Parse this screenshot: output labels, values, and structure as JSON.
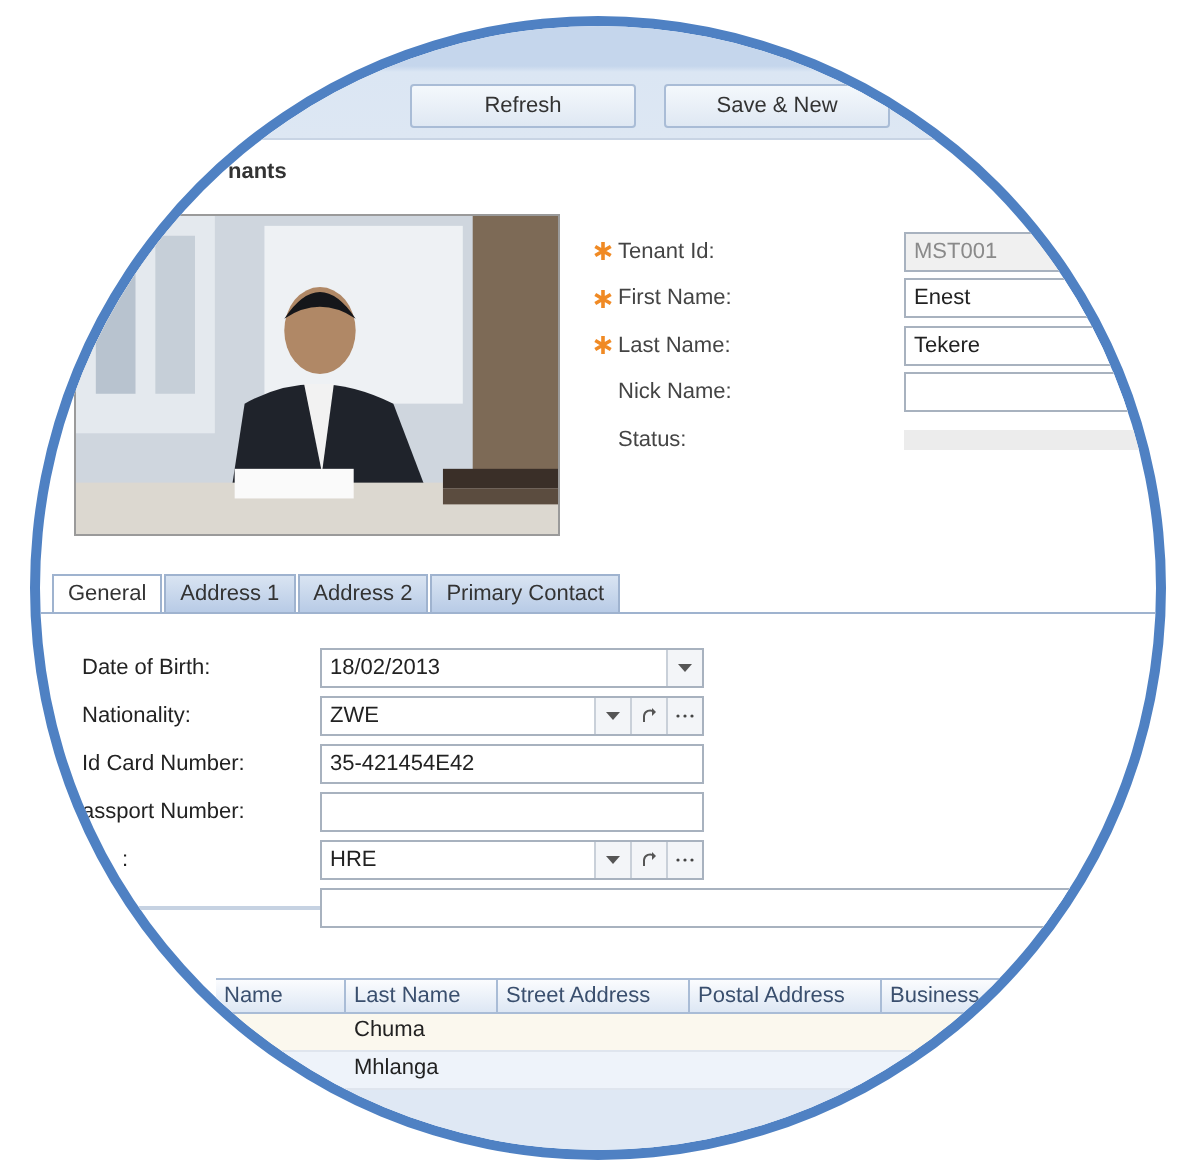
{
  "toolbar": {
    "buttons": [
      "Refresh",
      "Save & New"
    ]
  },
  "title": "nants",
  "tenant_fields": [
    {
      "label": "Tenant Id:",
      "required": true,
      "value": "MST001",
      "disabled": true,
      "kind": "text"
    },
    {
      "label": "First Name:",
      "required": true,
      "value": "Enest",
      "disabled": false,
      "kind": "text"
    },
    {
      "label": "Last Name:",
      "required": true,
      "value": "Tekere",
      "disabled": false,
      "kind": "text"
    },
    {
      "label": "Nick Name:",
      "required": false,
      "disabled": false,
      "kind": "text"
    },
    {
      "label": "Status:",
      "required": false,
      "disabled": true,
      "kind": "status"
    }
  ],
  "tabs": [
    {
      "label": "General",
      "selected": true
    },
    {
      "label": "Address 1",
      "selected": false
    },
    {
      "label": "Address 2",
      "selected": false
    },
    {
      "label": "Primary Contact",
      "selected": false
    }
  ],
  "general_fields": [
    {
      "label": "Date of Birth:",
      "value": "18/02/2013",
      "kind": "date"
    },
    {
      "label": "Nationality:",
      "value": "ZWE",
      "kind": "lookup"
    },
    {
      "label": "Id Card Number:",
      "value": "35-421454E42",
      "kind": "text"
    },
    {
      "label": "assport Number:",
      "kind": "text"
    },
    {
      "label": ":",
      "value": "HRE",
      "kind": "lookup"
    },
    {
      "kind": "wide"
    }
  ],
  "grid": {
    "columns": [
      "Name",
      "Last Name",
      "Street Address",
      "Postal Address",
      "Business"
    ],
    "rows": [
      {
        "last_name": "Chuma"
      },
      {
        "last_name": "Mhlanga"
      }
    ]
  }
}
